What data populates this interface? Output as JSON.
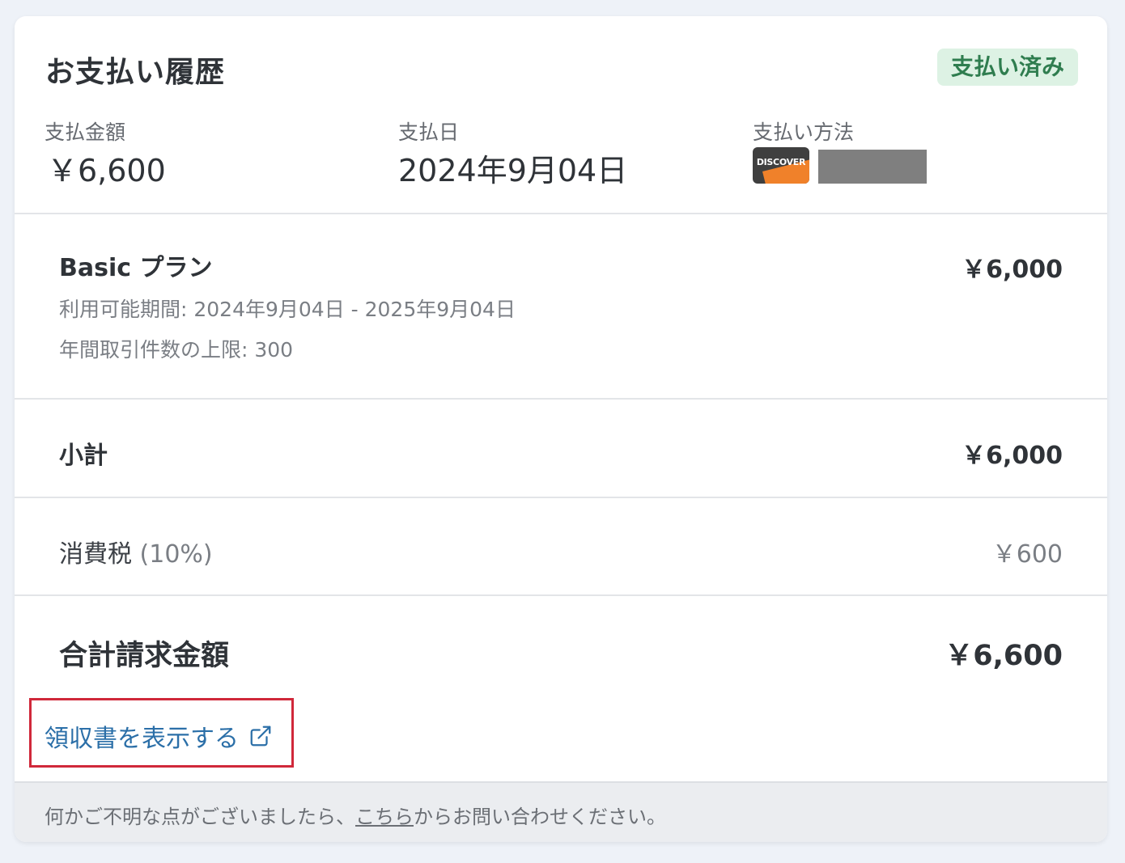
{
  "header": {
    "title": "お支払い履歴",
    "status": "支払い済み",
    "amount_label": "支払金額",
    "amount_value": "￥6,600",
    "date_label": "支払日",
    "date_value": "2024年9月04日",
    "method_label": "支払い方法",
    "card_brand": "DISCOVER"
  },
  "plan": {
    "name": "Basic プラン",
    "price": "￥6,000",
    "period": "利用可能期間: 2024年9月04日 - 2025年9月04日",
    "limit": "年間取引件数の上限: 300"
  },
  "subtotal": {
    "label": "小計",
    "value": "￥6,000"
  },
  "tax": {
    "label": "消費税",
    "rate": "(10%)",
    "value": "￥600"
  },
  "total": {
    "label": "合計請求金額",
    "value": "￥6,600"
  },
  "receipt": {
    "label": "領収書を表示する",
    "icon": "external-link-icon"
  },
  "footer": {
    "before": "何かご不明な点がございましたら、",
    "link": "こちら",
    "after": "からお問い合わせください。"
  },
  "colors": {
    "status_bg": "#ddf2e4",
    "status_text": "#2f7d4f",
    "link": "#2b6fa8",
    "highlight": "#d0283a",
    "card_orange": "#f0812a"
  }
}
